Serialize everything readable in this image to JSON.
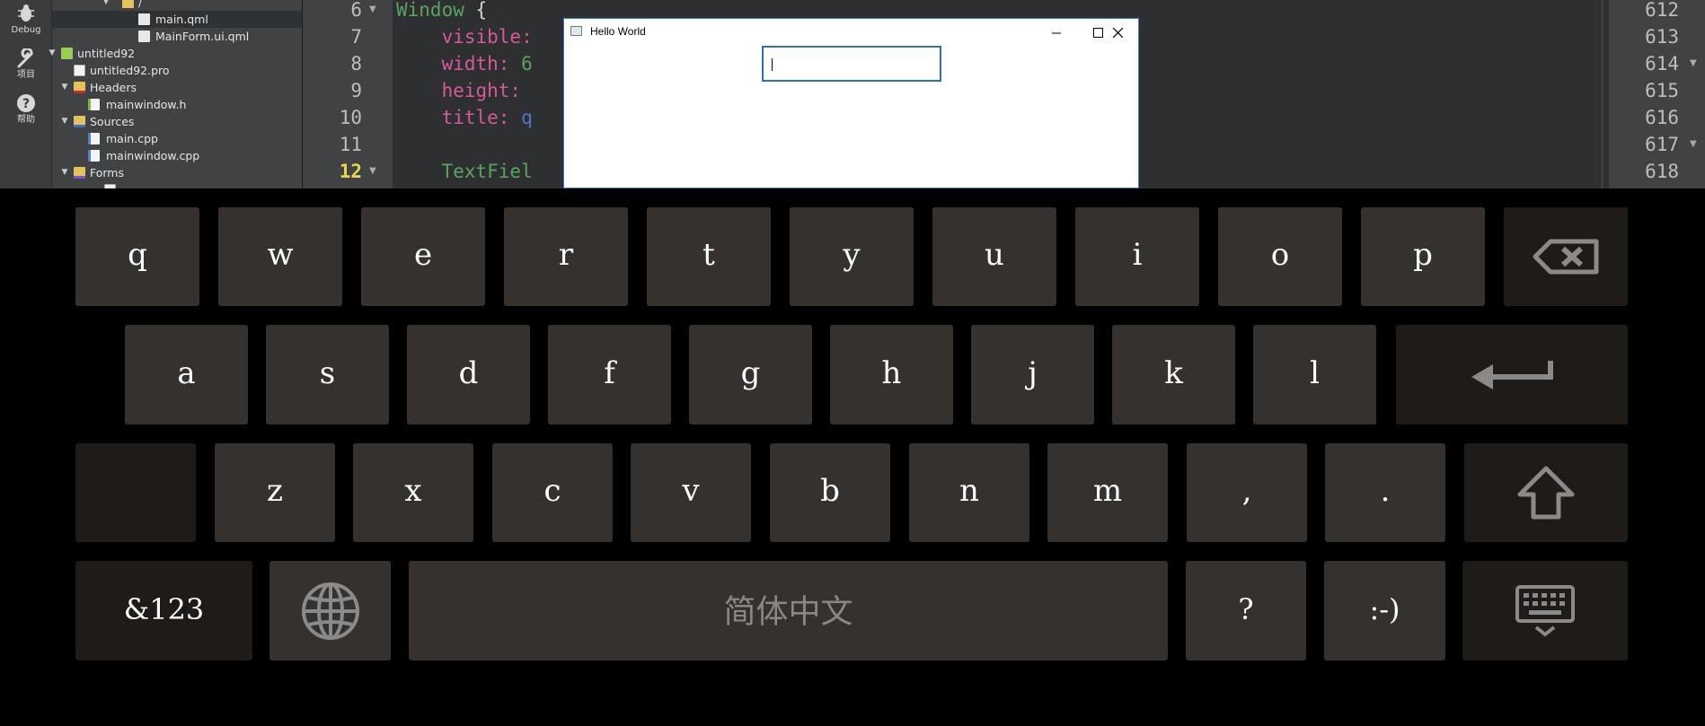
{
  "ide": {
    "mode_bar": [
      {
        "name": "debug",
        "label": "Debug"
      },
      {
        "name": "project",
        "label": "项目"
      },
      {
        "name": "help",
        "label": "帮助"
      }
    ],
    "tree": {
      "slash_folder": "/",
      "main_qml": "main.qml",
      "mainform_ui_qml": "MainForm.ui.qml",
      "project": "untitled92",
      "pro_file": "untitled92.pro",
      "headers": "Headers",
      "mainwindow_h": "mainwindow.h",
      "sources": "Sources",
      "main_cpp": "main.cpp",
      "mainwindow_cpp": "mainwindow.cpp",
      "forms": "Forms"
    },
    "editor": {
      "line_numbers": [
        "6",
        "7",
        "8",
        "9",
        "10",
        "11",
        "12"
      ],
      "lines": [
        {
          "type": "Window",
          "rest": " {"
        },
        {
          "prop": "visible:",
          "rest": ""
        },
        {
          "prop": "width:",
          "rest": " 6"
        },
        {
          "prop": "height:",
          "rest": ""
        },
        {
          "prop": "title:",
          "rest": " q"
        },
        {
          "prop": "",
          "rest": ""
        },
        {
          "type": "TextFiel",
          "rest": ""
        }
      ]
    },
    "right_line_numbers": [
      "612",
      "613",
      "614",
      "615",
      "616",
      "617",
      "618"
    ]
  },
  "hello_window": {
    "title": "Hello World",
    "textfield_value": ""
  },
  "keyboard": {
    "row1": [
      "q",
      "w",
      "e",
      "r",
      "t",
      "y",
      "u",
      "i",
      "o",
      "p"
    ],
    "row2": [
      "a",
      "s",
      "d",
      "f",
      "g",
      "h",
      "j",
      "k",
      "l"
    ],
    "row3": [
      "z",
      "x",
      "c",
      "v",
      "b",
      "n",
      "m",
      ",",
      "."
    ],
    "symbols_key": "&123",
    "space_label": "简体中文",
    "question_key": "?",
    "smiley_key": ":-)",
    "icons": {
      "backspace": "backspace-icon",
      "enter": "enter-icon",
      "shift": "shift-icon",
      "language": "globe-icon",
      "hide": "hide-keyboard-icon"
    },
    "colors": {
      "key_bg": "#35312e",
      "key_dark_bg": "#1e1b19",
      "key_text": "#ffffff",
      "icon": "#8c8a88"
    }
  }
}
